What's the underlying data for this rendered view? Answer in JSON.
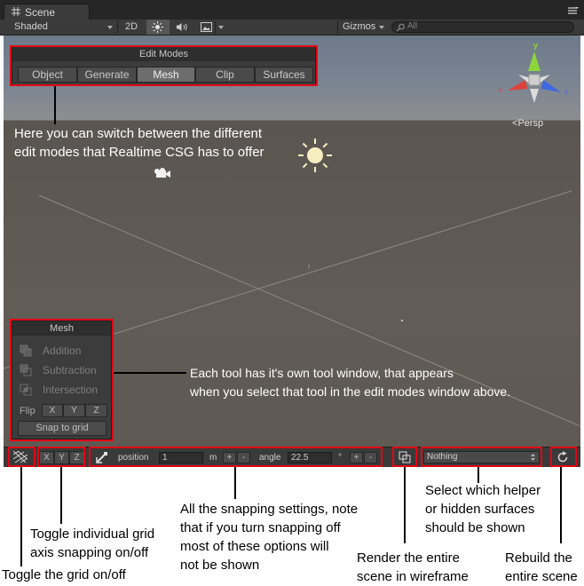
{
  "window": {
    "tab_label": "Scene",
    "tab_icon": "grid-icon",
    "menu_icon": "hamburger-menu-icon"
  },
  "toolbar": {
    "shading_mode": "Shaded",
    "btn_2d": "2D",
    "lighting_icon": "sun-icon",
    "audio_icon": "speaker-icon",
    "effects_icon": "image-icon",
    "gizmos_label": "Gizmos",
    "search_placeholder": "All"
  },
  "scene": {
    "projection_label": "Persp",
    "gizmo_axes": {
      "x": "x",
      "y": "y",
      "z": "z"
    },
    "colors": {
      "x_axis": "#e0403a",
      "y_axis": "#8cd63c",
      "z_axis": "#3d6ae0"
    }
  },
  "edit_modes": {
    "title": "Edit Modes",
    "modes": [
      {
        "label": "Object",
        "selected": false
      },
      {
        "label": "Generate",
        "selected": false
      },
      {
        "label": "Mesh",
        "selected": true
      },
      {
        "label": "Clip",
        "selected": false
      },
      {
        "label": "Surfaces",
        "selected": false
      }
    ]
  },
  "mesh_panel": {
    "title": "Mesh",
    "operations": [
      "Addition",
      "Subtraction",
      "Intersection"
    ],
    "flip_label": "Flip",
    "flip_axes": [
      "X",
      "Y",
      "Z"
    ],
    "snap_button": "Snap to grid"
  },
  "bottom_bar": {
    "grid_toggle_icon": "grid-toggle-icon",
    "axis_buttons": [
      "X",
      "Y",
      "Z"
    ],
    "snap_icon": "snap-icon",
    "position_label": "position",
    "position_value": "1",
    "position_unit": "m",
    "plus": "+",
    "minus": "-",
    "angle_label": "angle",
    "angle_value": "22.5",
    "angle_unit": "°",
    "wireframe_icon": "wireframe-icon",
    "helper_surfaces_value": "Nothing",
    "rebuild_icon": "refresh-icon"
  },
  "annotations": {
    "edit_modes_note": [
      "Here you can switch between the different",
      "edit modes that Realtime CSG has to offer"
    ],
    "tool_window_note": [
      "Each tool has it's own tool window, that appears",
      "when you select that tool in the edit modes window above."
    ],
    "grid_toggle": "Toggle the grid on/off",
    "axis_snapping": [
      "Toggle individual grid",
      "axis snapping on/off"
    ],
    "snapping_settings": [
      "All the snapping settings, note",
      "that if you turn snapping off",
      "most of these options will",
      "not be shown"
    ],
    "wireframe": [
      "Render the entire",
      "scene in wireframe"
    ],
    "helper_surfaces": [
      "Select which helper",
      "or hidden surfaces",
      "should be shown"
    ],
    "rebuild": [
      "Rebuild the",
      "entire scene"
    ]
  }
}
